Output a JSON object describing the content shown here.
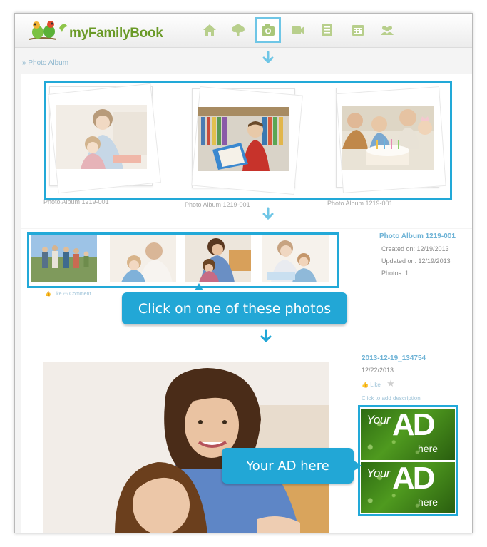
{
  "app": {
    "name": "myFamilyBook"
  },
  "nav": {
    "items": [
      "home-icon",
      "tree-icon",
      "camera-icon",
      "video-icon",
      "document-icon",
      "calendar-icon",
      "people-icon"
    ],
    "active": "camera-icon"
  },
  "breadcrumb": {
    "text": "» Photo Album"
  },
  "albums": [
    {
      "caption": "Photo Album 1219-001"
    },
    {
      "caption": "Photo Album 1219-001"
    },
    {
      "caption": "Photo Album 1219-001"
    }
  ],
  "album_info": {
    "title": "Photo Album 1219-001",
    "created": "Created on: 12/19/2013",
    "updated": "Updated on: 12/19/2013",
    "photos": "Photos: 1"
  },
  "thumb_actions": {
    "like": "Like",
    "comment": "Comment"
  },
  "callouts": {
    "click_photo": "Click on one of these photos",
    "ad": "Your AD here"
  },
  "photo_info": {
    "title": "2013-12-19_134754",
    "date": "12/22/2013",
    "like": "Like",
    "add_description": "Click to add description"
  },
  "ads": [
    {
      "your": "Your",
      "big": "AD",
      "here": "here"
    },
    {
      "your": "Your",
      "big": "AD",
      "here": "here"
    }
  ],
  "colors": {
    "accent": "#22a9d8",
    "brand_green": "#6a9a27",
    "link": "#8fb8cf"
  }
}
